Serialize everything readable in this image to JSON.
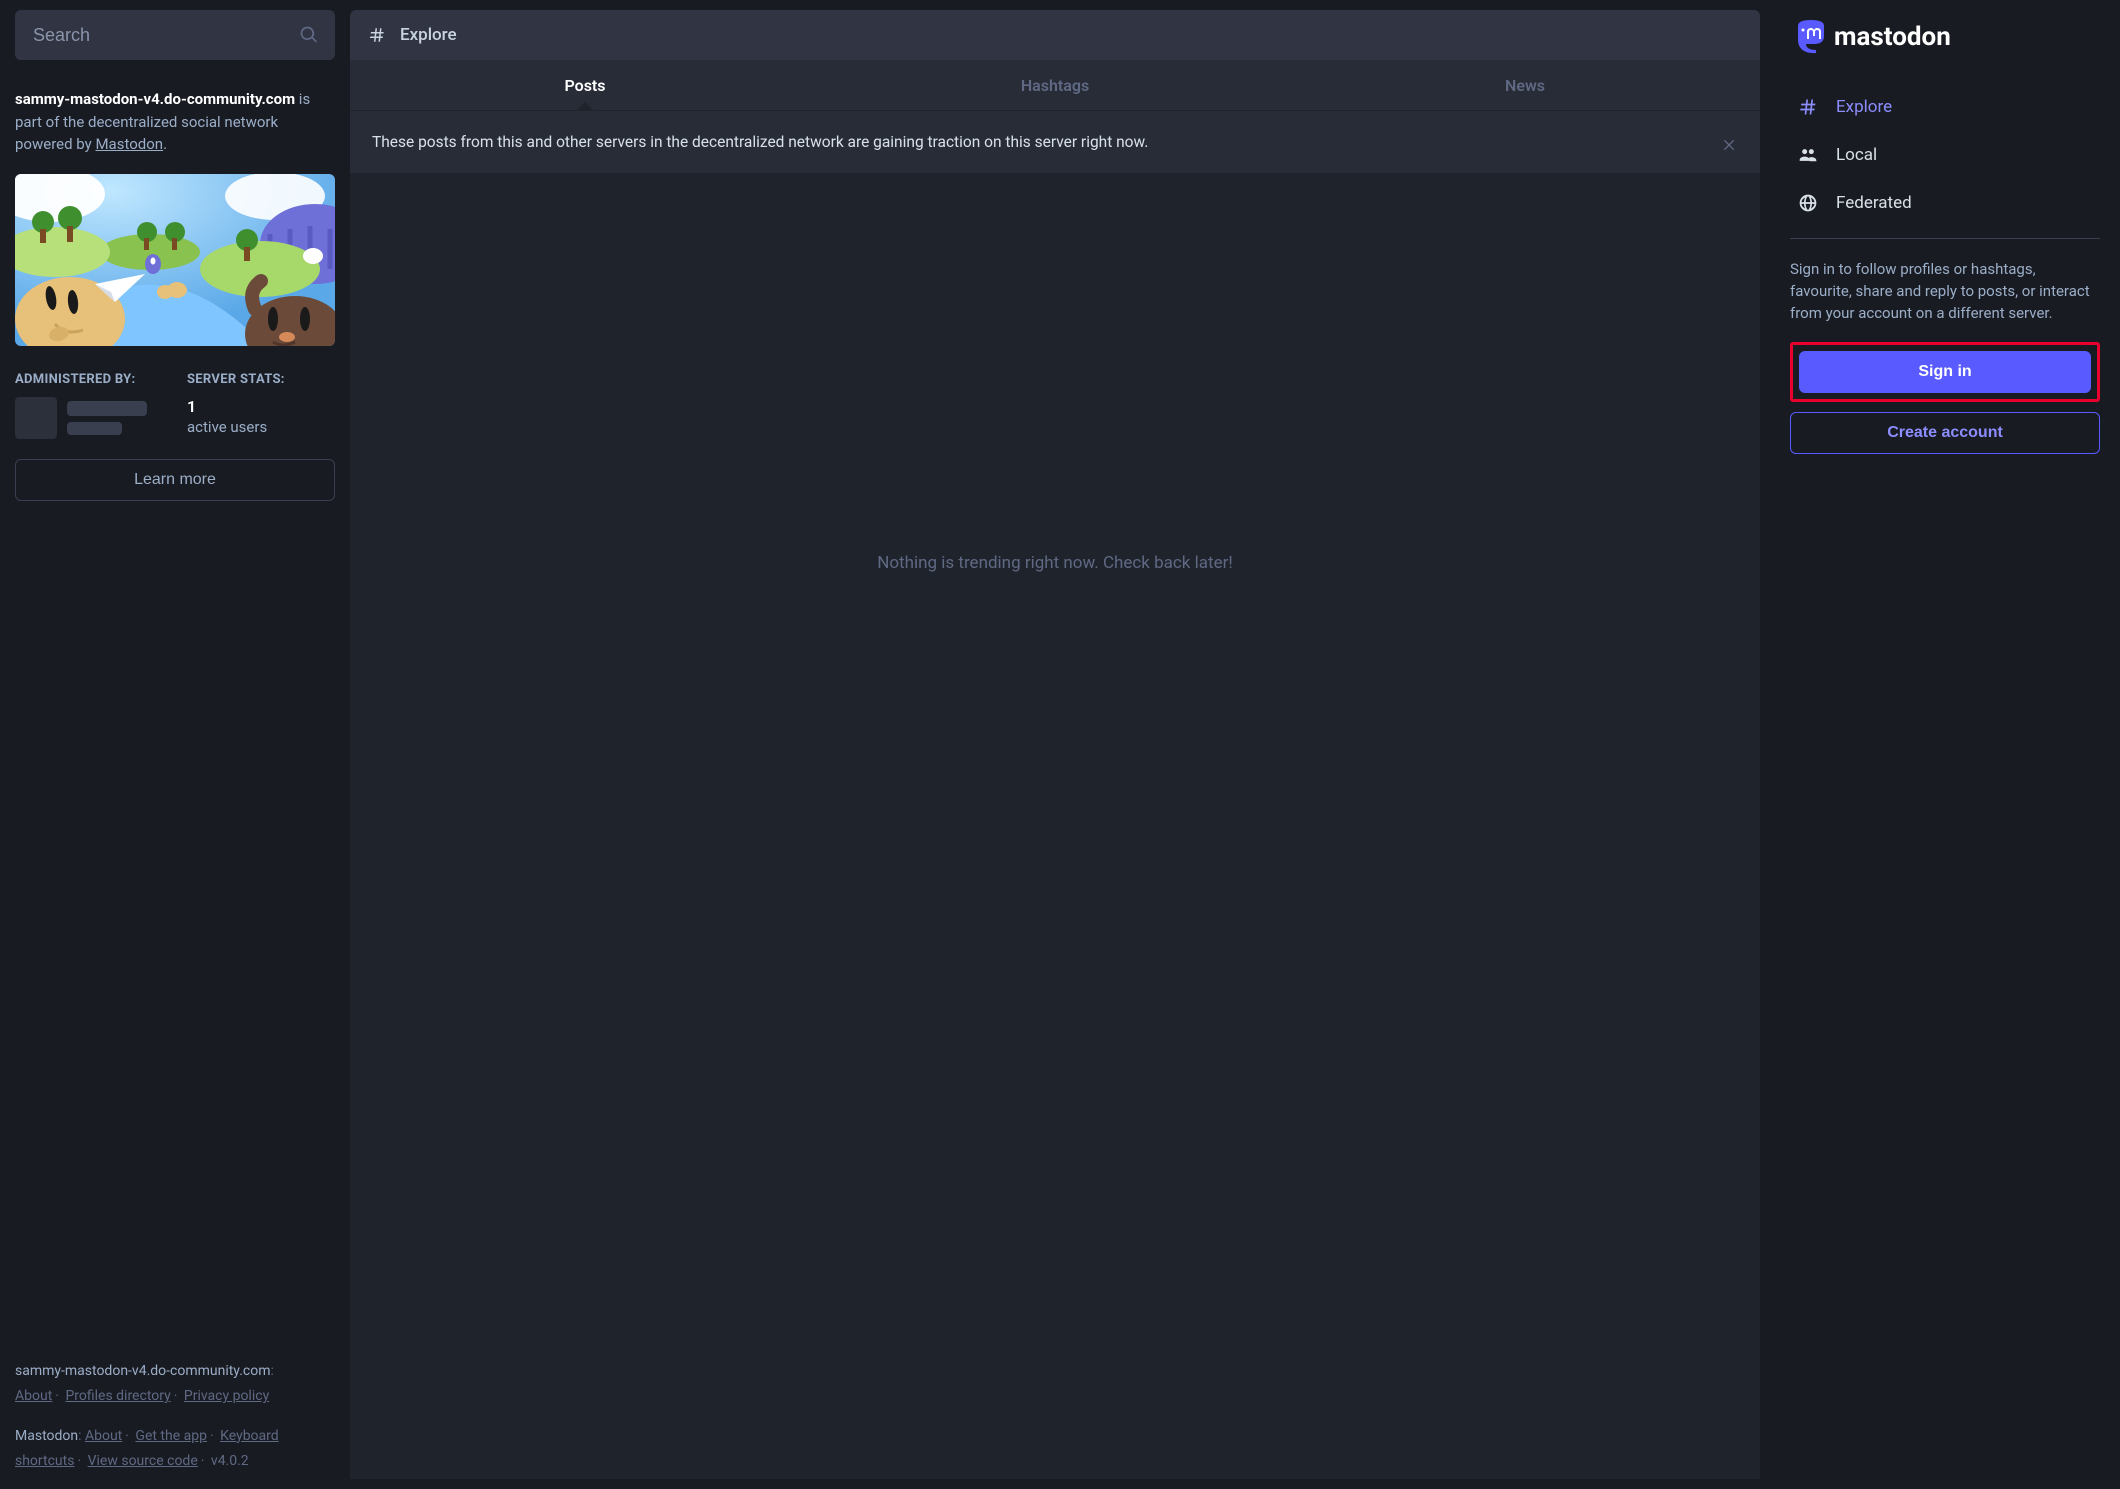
{
  "search": {
    "placeholder": "Search"
  },
  "server": {
    "domain": "sammy-mastodon-v4.do-community.com",
    "desc_prefix": " is part of the decentralized social network powered by ",
    "brand": "Mastodon",
    "desc_suffix": ".",
    "admin_label": "ADMINISTERED BY:",
    "stats_label": "SERVER STATS:",
    "active_users_count": "1",
    "active_users_caption": "active users",
    "learn_more": "Learn more"
  },
  "footer": {
    "server_domain": "sammy-mastodon-v4.do-community.com",
    "server_colon": ":",
    "about": "About",
    "profiles": "Profiles directory",
    "privacy": "Privacy policy",
    "brand": "Mastodon",
    "brand_colon": ": ",
    "about2": "About",
    "get_app": "Get the app",
    "kb": "Keyboard shortcuts",
    "source": "View source code",
    "version": "v4.0.2"
  },
  "explore": {
    "title": "Explore",
    "tabs": {
      "posts": "Posts",
      "hashtags": "Hashtags",
      "news": "News"
    },
    "banner": "These posts from this and other servers in the decentralized network are gaining traction on this server right now.",
    "empty": "Nothing is trending right now. Check back later!"
  },
  "logo": {
    "text": "mastodon"
  },
  "nav": {
    "explore": "Explore",
    "local": "Local",
    "federated": "Federated"
  },
  "auth": {
    "prompt": "Sign in to follow profiles or hashtags, favourite, share and reply to posts, or interact from your account on a different server.",
    "signin": "Sign in",
    "create": "Create account"
  }
}
